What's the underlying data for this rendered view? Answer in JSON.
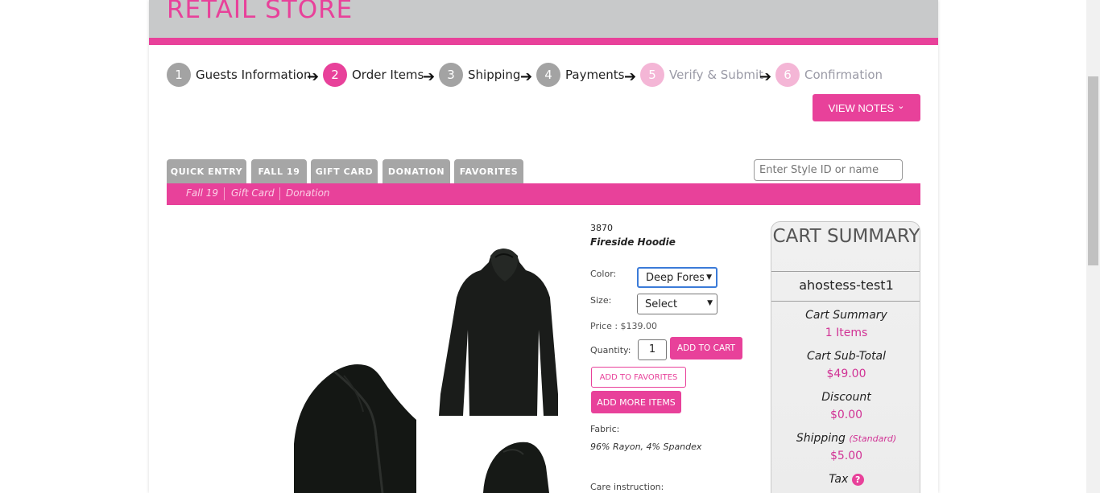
{
  "header": {
    "title": "RETAIL STORE"
  },
  "steps": [
    {
      "number": "1",
      "label": "Guests Information",
      "state": "done"
    },
    {
      "number": "2",
      "label": "Order Items",
      "state": "active"
    },
    {
      "number": "3",
      "label": "Shipping",
      "state": "done"
    },
    {
      "number": "4",
      "label": "Payments",
      "state": "done"
    },
    {
      "number": "5",
      "label": "Verify & Submit",
      "state": "pending"
    },
    {
      "number": "6",
      "label": "Confirmation",
      "state": "pending"
    }
  ],
  "step_arrow": "➔",
  "view_notes": {
    "label": "VIEW NOTES",
    "caret": "⌄"
  },
  "tabs": [
    "QUICK ENTRY",
    "FALL 19",
    "GIFT CARD",
    "DONATION",
    "FAVORITES"
  ],
  "search": {
    "placeholder": "Enter Style ID or name"
  },
  "sub_links": [
    "Fall 19",
    "Gift Card",
    "Donation"
  ],
  "product": {
    "style_id": "3870",
    "name": "Fireside Hoodie",
    "color_label": "Color:",
    "color_value": "Deep Fores",
    "size_label": "Size:",
    "size_value": "Select",
    "price": "Price : $139.00",
    "quantity_label": "Quantity:",
    "quantity": "1",
    "add_to_cart": "ADD TO CART",
    "add_to_favorites": "ADD TO FAVORITES",
    "add_more_items": "ADD MORE ITEMS",
    "fabric_label": "Fabric:",
    "fabric_value": "96% Rayon, 4% Spandex",
    "care_label": "Care instruction:"
  },
  "cart": {
    "title": "CART SUMMARY",
    "user": "ahostess-test1",
    "summary_label": "Cart Summary",
    "items": "1 Items",
    "subtotal_label": "Cart Sub-Total",
    "subtotal": "$49.00",
    "discount_label": "Discount",
    "discount": "$0.00",
    "shipping_label": "Shipping",
    "shipping_note": "(Standard)",
    "shipping": "$5.00",
    "tax_label": "Tax",
    "tax_help": "?"
  },
  "colors": {
    "accent": "#e8419a",
    "header_gray": "#c8c9ca",
    "tab_gray": "#a6a6a6"
  }
}
